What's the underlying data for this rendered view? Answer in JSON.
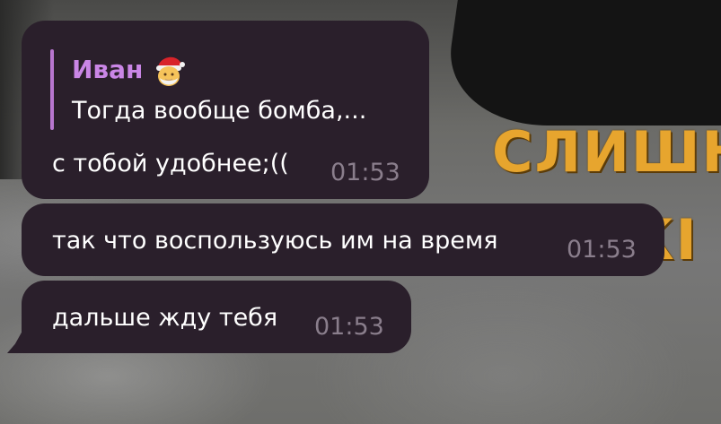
{
  "background": {
    "caption_line_1": "СЛИШН",
    "caption_line_2": "КІ"
  },
  "colors": {
    "bubble": "#2a1f2b",
    "author": "#ca86e6",
    "reply_bar": "#b876cf",
    "time": "#8a7e8c",
    "text": "#ffffff"
  },
  "messages": [
    {
      "reply": {
        "author": "Иван",
        "author_emoji": "santa-face-emoji",
        "text": "Тогда вообще бомба,..."
      },
      "text": "с тобой удобнее;((",
      "time": "01:53"
    },
    {
      "text": "так что воспользуюсь им на время",
      "time": "01:53"
    },
    {
      "text": "дальше жду тебя",
      "time": "01:53"
    }
  ]
}
